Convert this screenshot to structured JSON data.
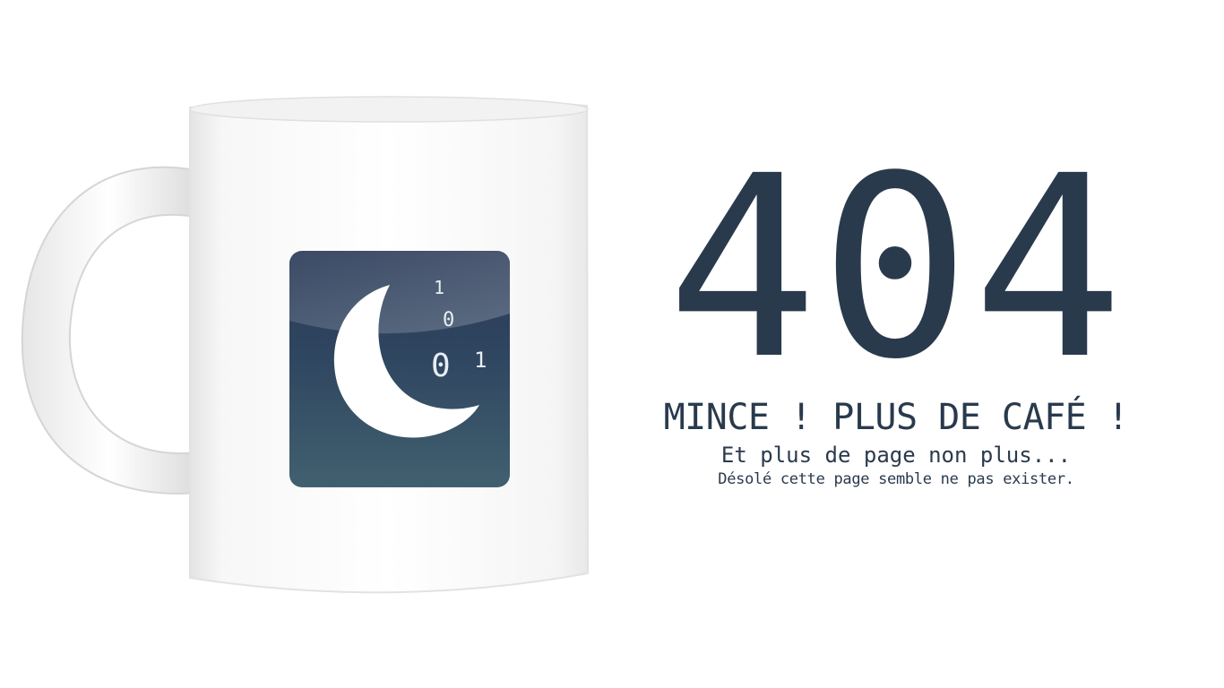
{
  "error": {
    "code": "404",
    "headline": "MINCE ! PLUS DE CAFÉ !",
    "subline": "Et plus de page non plus...",
    "note": "Désolé cette page semble ne pas exister."
  },
  "logo": {
    "binary_digits": [
      "1",
      "0",
      "0",
      "1"
    ],
    "colors": {
      "top": "#2b3a58",
      "bottom": "#41606f",
      "moon": "#ffffff"
    }
  },
  "colors": {
    "text": "#2a3a4d",
    "background": "#ffffff"
  }
}
